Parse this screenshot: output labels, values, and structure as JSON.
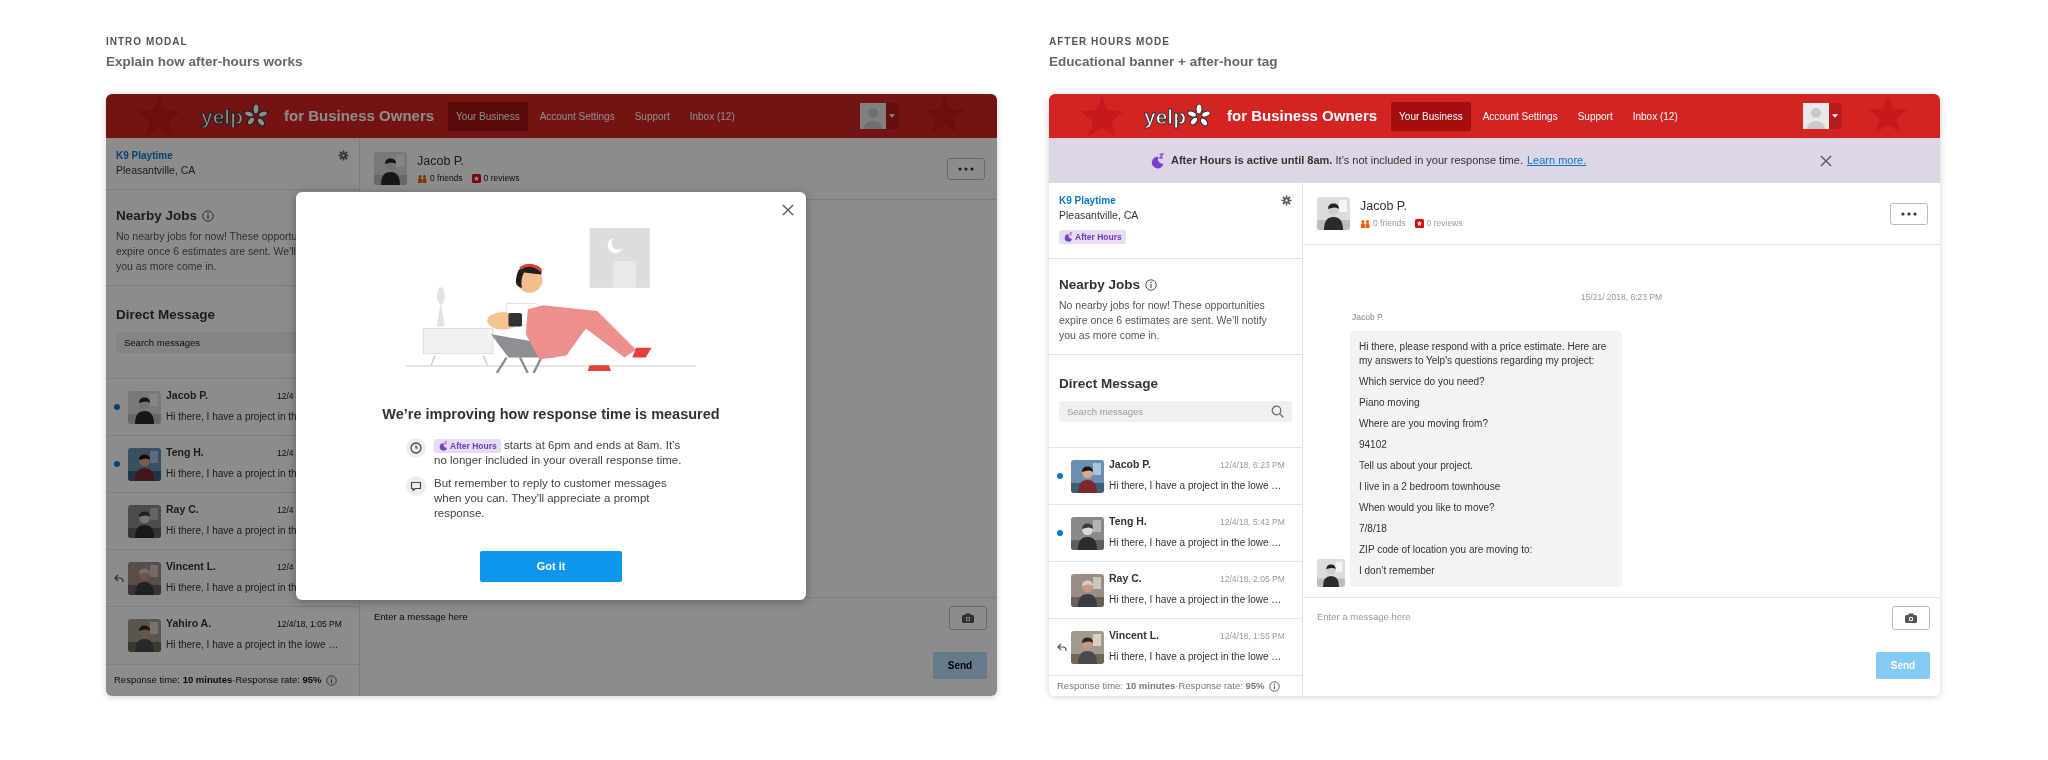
{
  "sections": [
    {
      "eyebrow": "INTRO MODAL",
      "heading": "Explain how after-hours works",
      "app": {
        "nav": {
          "logo": "yelp",
          "brand": "for Business Owners",
          "links": [
            {
              "label": "Your Business",
              "selected": true
            },
            {
              "label": "Account Settings",
              "selected": false
            },
            {
              "label": "Support",
              "selected": false
            },
            {
              "label": "Inbox (12)",
              "selected": false
            }
          ]
        },
        "business": {
          "name": "K9 Playtime",
          "location": "Pleasantville, CA"
        },
        "nearby": {
          "title": "Nearby Jobs",
          "lines": [
            "No nearby jobs for now! These opportu",
            "expire once 6 estimates are sent. We'll",
            "you as more come in."
          ]
        },
        "direct": {
          "title": "Direct Message",
          "search_placeholder": "Search messages",
          "conversations": [
            {
              "name": "Jacob P.",
              "time": "12/4",
              "preview": "Hi there, I have a project in th",
              "unread": true,
              "replied": false
            },
            {
              "name": "Teng H.",
              "time": "12/4",
              "preview": "Hi there, I have a project in th",
              "unread": true,
              "replied": false
            },
            {
              "name": "Ray C.",
              "time": "12/4",
              "preview": "Hi there, I have a project in th",
              "unread": false,
              "replied": false
            },
            {
              "name": "Vincent L.",
              "time": "12/4",
              "preview": "Hi there, I have a project in th",
              "unread": false,
              "replied": true
            },
            {
              "name": "Yahiro A.",
              "time": "12/4/18, 1:05 PM",
              "preview": "Hi there, I have a project in the lowe …",
              "unread": false,
              "replied": false
            }
          ]
        },
        "footer": "Response time: **10 minutes**·Response rate: **95%**",
        "thread": {
          "name": "Jacob P.",
          "friends": "0 friends",
          "reviews": "0 reviews"
        },
        "composer": {
          "placeholder": "Enter a message here",
          "send": {
            "label": "Send",
            "disabled": true
          }
        }
      },
      "modal": {
        "title": "We’re improving how response time is measured",
        "items": [
          {
            "kind": "clock",
            "tag": "After Hours",
            "text": "starts at 6pm and ends at 8am. It’s no longer included in your overall response time."
          },
          {
            "kind": "message",
            "text": "But remember to reply to customer messages when you can. They'll appreciate a prompt response."
          }
        ],
        "button": "Got it"
      }
    },
    {
      "eyebrow": "AFTER HOURS MODE",
      "heading": "Educational banner + after-hour tag",
      "app": {
        "nav": {
          "logo": "yelp",
          "brand": "for Business Owners",
          "links": [
            {
              "label": "Your Business",
              "selected": true
            },
            {
              "label": "Account Settings",
              "selected": false
            },
            {
              "label": "Support",
              "selected": false
            },
            {
              "label": "Inbox (12)",
              "selected": false
            }
          ]
        },
        "banner": {
          "text": "**After Hours is active until 8am.** It’s not included in your response time.",
          "link": "Learn more."
        },
        "business": {
          "name": "K9 Playtime",
          "location": "Pleasantville, CA",
          "tag": "After Hours"
        },
        "nearby": {
          "title": "Nearby Jobs",
          "lines": [
            "No nearby jobs for now! These opportunities",
            "expire once 6 estimates are sent. We'll notify",
            "you as more come in."
          ]
        },
        "direct": {
          "title": "Direct Message",
          "search_placeholder": "Search messages",
          "conversations": [
            {
              "name": "Jacob P.",
              "time": "12/4/18, 6:23 PM",
              "preview": "Hi there, I have a project in the lowe …",
              "unread": true,
              "replied": false
            },
            {
              "name": "Teng H.",
              "time": "12/4/18, 5:42 PM",
              "preview": "Hi there, I have a project in the lowe …",
              "unread": true,
              "replied": false
            },
            {
              "name": "Ray C.",
              "time": "12/4/18, 2:05 PM",
              "preview": "Hi there, I have a project in the lowe …",
              "unread": false,
              "replied": false
            },
            {
              "name": "Vincent L.",
              "time": "12/4/18, 1:55 PM",
              "preview": "Hi there, I have a project in the lowe …",
              "unread": false,
              "replied": true
            }
          ]
        },
        "footer": "Response time: **10 minutes**·Response rate: **95%**",
        "thread": {
          "name": "Jacob P.",
          "friends": "0 friends",
          "reviews": "0 reviews",
          "date": "15/21/ 2018, 6:23 PM",
          "sender": "Jacob P.",
          "messages": [
            "Hi there, please respond with a price estimate. Here are my answers to Yelp's questions regarding my project:",
            "Which service do you need?",
            "Piano moving",
            "Where are you moving from?",
            "94102",
            "Tell us about your project.",
            "I live in a 2 bedroom townhouse",
            "When would you like to move?",
            "7/8/18",
            "ZIP code of location you are moving to:",
            "I don’t remember"
          ]
        },
        "composer": {
          "placeholder": "Enter a message here",
          "send": {
            "label": "Send",
            "disabled": true
          }
        }
      }
    }
  ]
}
